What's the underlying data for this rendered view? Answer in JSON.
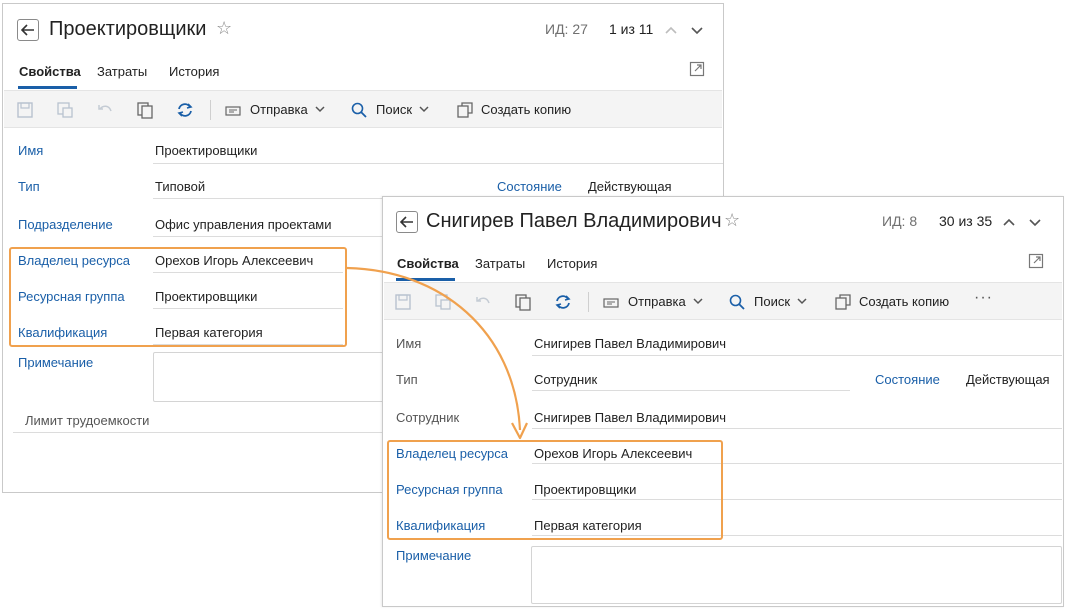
{
  "window1": {
    "title": "Проектировщики",
    "id_label": "ИД: 27",
    "pager": "1 из 11",
    "tabs": [
      "Свойства",
      "Затраты",
      "История"
    ],
    "toolbar": {
      "send": "Отправка",
      "search": "Поиск",
      "copy": "Создать копию"
    },
    "fields": {
      "name_label": "Имя",
      "name_value": "Проектировщики",
      "type_label": "Тип",
      "type_value": "Типовой",
      "state_label": "Состояние",
      "state_value": "Действующая",
      "dept_label": "Подразделение",
      "dept_value": "Офис управления проектами",
      "owner_label": "Владелец ресурса",
      "owner_value": "Орехов Игорь Алексеевич",
      "group_label": "Ресурсная группа",
      "group_value": "Проектировщики",
      "qual_label": "Квалификация",
      "qual_value": "Первая категория",
      "note_label": "Примечание",
      "limit_label": "Лимит трудоемкости"
    }
  },
  "window2": {
    "title": "Снигирев Павел Владимирович",
    "id_label": "ИД: 8",
    "pager": "30 из 35",
    "tabs": [
      "Свойства",
      "Затраты",
      "История"
    ],
    "toolbar": {
      "send": "Отправка",
      "search": "Поиск",
      "copy": "Создать копию",
      "more": "···"
    },
    "fields": {
      "name_label": "Имя",
      "name_value": "Снигирев Павел Владимирович",
      "type_label": "Тип",
      "type_value": "Сотрудник",
      "state_label": "Состояние",
      "state_value": "Действующая",
      "employee_label": "Сотрудник",
      "employee_value": "Снигирев Павел Владимирович",
      "owner_label": "Владелец ресурса",
      "owner_value": "Орехов Игорь Алексеевич",
      "group_label": "Ресурсная группа",
      "group_value": "Проектировщики",
      "qual_label": "Квалификация",
      "qual_value": "Первая категория",
      "note_label": "Примечание"
    }
  },
  "colors": {
    "accent": "#1a5fa8",
    "highlight": "#f0a14e",
    "label_blue": "#1a5fa8"
  }
}
